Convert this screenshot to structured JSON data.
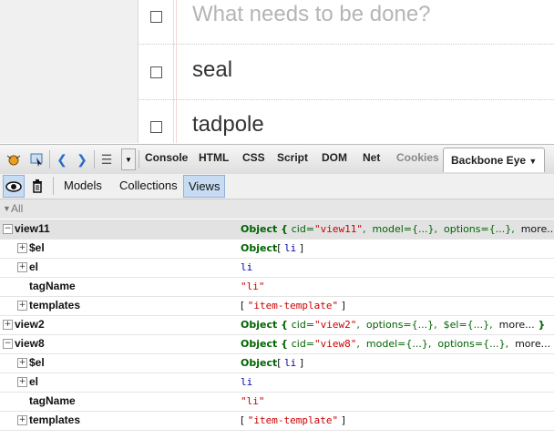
{
  "todo": {
    "placeholder": "What needs to be done?",
    "items": [
      "seal",
      "tadpole"
    ]
  },
  "firebug": {
    "tabs": [
      "Console",
      "HTML",
      "CSS",
      "Script",
      "DOM",
      "Net",
      "Cookies",
      "Backbone Eye"
    ],
    "active_tab": "Backbone Eye",
    "subtabs": [
      "Models",
      "Collections",
      "Views"
    ],
    "active_subtab": "Views"
  },
  "tree": {
    "all_label": "All",
    "rows": [
      {
        "key": "view11",
        "toggle": "−",
        "value": [
          [
            "Object { ",
            "g"
          ],
          [
            "cid=",
            "gb"
          ],
          [
            "\"view11\"",
            "r"
          ],
          [
            ",  ",
            "gb"
          ],
          [
            "model={...}",
            "gb"
          ],
          [
            ",  ",
            "gb"
          ],
          [
            "options={...}",
            "gb"
          ],
          [
            ",  ",
            "gb"
          ],
          [
            "more...",
            "k"
          ]
        ]
      },
      {
        "key": "$el",
        "toggle": "+",
        "value": [
          [
            "Object",
            "g"
          ],
          [
            "[ ",
            "k"
          ],
          [
            "li",
            "b"
          ],
          [
            " ]",
            "k"
          ]
        ]
      },
      {
        "key": "el",
        "toggle": "+",
        "value": [
          [
            "li",
            "b"
          ]
        ]
      },
      {
        "key": "tagName",
        "toggle": "",
        "value": [
          [
            "\"li\"",
            "r"
          ]
        ]
      },
      {
        "key": "templates",
        "toggle": "+",
        "value": [
          [
            "[ ",
            "k"
          ],
          [
            "\"item-template\"",
            "r"
          ],
          [
            " ]",
            "k"
          ]
        ]
      },
      {
        "key": "view2",
        "toggle": "+",
        "value": [
          [
            "Object { ",
            "g"
          ],
          [
            "cid=",
            "gb"
          ],
          [
            "\"view2\"",
            "r"
          ],
          [
            ",  ",
            "gb"
          ],
          [
            "options={...}",
            "gb"
          ],
          [
            ",  ",
            "gb"
          ],
          [
            "$el={...}",
            "gb"
          ],
          [
            ",  ",
            "gb"
          ],
          [
            "more...",
            "k"
          ],
          [
            " }",
            "g"
          ]
        ]
      },
      {
        "key": "view8",
        "toggle": "−",
        "value": [
          [
            "Object { ",
            "g"
          ],
          [
            "cid=",
            "gb"
          ],
          [
            "\"view8\"",
            "r"
          ],
          [
            ",  ",
            "gb"
          ],
          [
            "model={...}",
            "gb"
          ],
          [
            ",  ",
            "gb"
          ],
          [
            "options={...}",
            "gb"
          ],
          [
            ",  ",
            "gb"
          ],
          [
            "more...",
            "k"
          ]
        ]
      },
      {
        "key": "$el",
        "toggle": "+",
        "value": [
          [
            "Object",
            "g"
          ],
          [
            "[ ",
            "k"
          ],
          [
            "li",
            "b"
          ],
          [
            " ]",
            "k"
          ]
        ]
      },
      {
        "key": "el",
        "toggle": "+",
        "value": [
          [
            "li",
            "b"
          ]
        ]
      },
      {
        "key": "tagName",
        "toggle": "",
        "value": [
          [
            "\"li\"",
            "r"
          ]
        ]
      },
      {
        "key": "templates",
        "toggle": "+",
        "value": [
          [
            "[ ",
            "k"
          ],
          [
            "\"item-template\"",
            "r"
          ],
          [
            " ]",
            "k"
          ]
        ]
      }
    ]
  }
}
